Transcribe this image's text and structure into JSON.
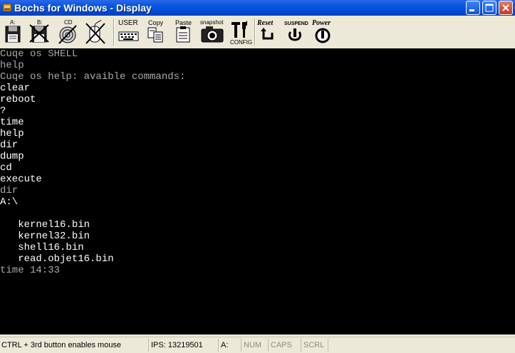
{
  "window": {
    "title": "Bochs for Windows - Display"
  },
  "toolbar": {
    "drive_a_label": "A:",
    "drive_b_label": "B:",
    "cdrom_label": "CD",
    "user_label": "USER",
    "copy_label": "Copy",
    "paste_label": "Paste",
    "snapshot_label": "snapshot",
    "config_label": "CONFIG",
    "reset_label": "Reset",
    "suspend_label": "SUSPEND",
    "power_label": "Power"
  },
  "console": {
    "lines": [
      {
        "text": "Cuqe os SHELL",
        "dim": true
      },
      {
        "text": "help",
        "dim": true
      },
      {
        "text": "Cuqe os help: avaible commands:",
        "dim": true
      },
      {
        "text": "clear",
        "dim": false
      },
      {
        "text": "reboot",
        "dim": false
      },
      {
        "text": "?",
        "dim": false
      },
      {
        "text": "time",
        "dim": false
      },
      {
        "text": "help",
        "dim": false
      },
      {
        "text": "dir",
        "dim": false
      },
      {
        "text": "dump",
        "dim": false
      },
      {
        "text": "cd",
        "dim": false
      },
      {
        "text": "execute",
        "dim": false
      },
      {
        "text": "dir",
        "dim": true
      },
      {
        "text": "A:\\",
        "dim": false
      },
      {
        "text": "",
        "dim": false
      },
      {
        "text": "   kernel16.bin",
        "dim": false
      },
      {
        "text": "   kernel32.bin",
        "dim": false
      },
      {
        "text": "   shell16.bin",
        "dim": false
      },
      {
        "text": "   read.objet16.bin",
        "dim": false
      },
      {
        "text": "time 14:33",
        "dim": true
      }
    ]
  },
  "statusbar": {
    "hint": "CTRL + 3rd button enables mouse",
    "ips": "IPS:  13219501",
    "drive": "A:",
    "num": "NUM",
    "caps": "CAPS",
    "scrl": "SCRL"
  }
}
